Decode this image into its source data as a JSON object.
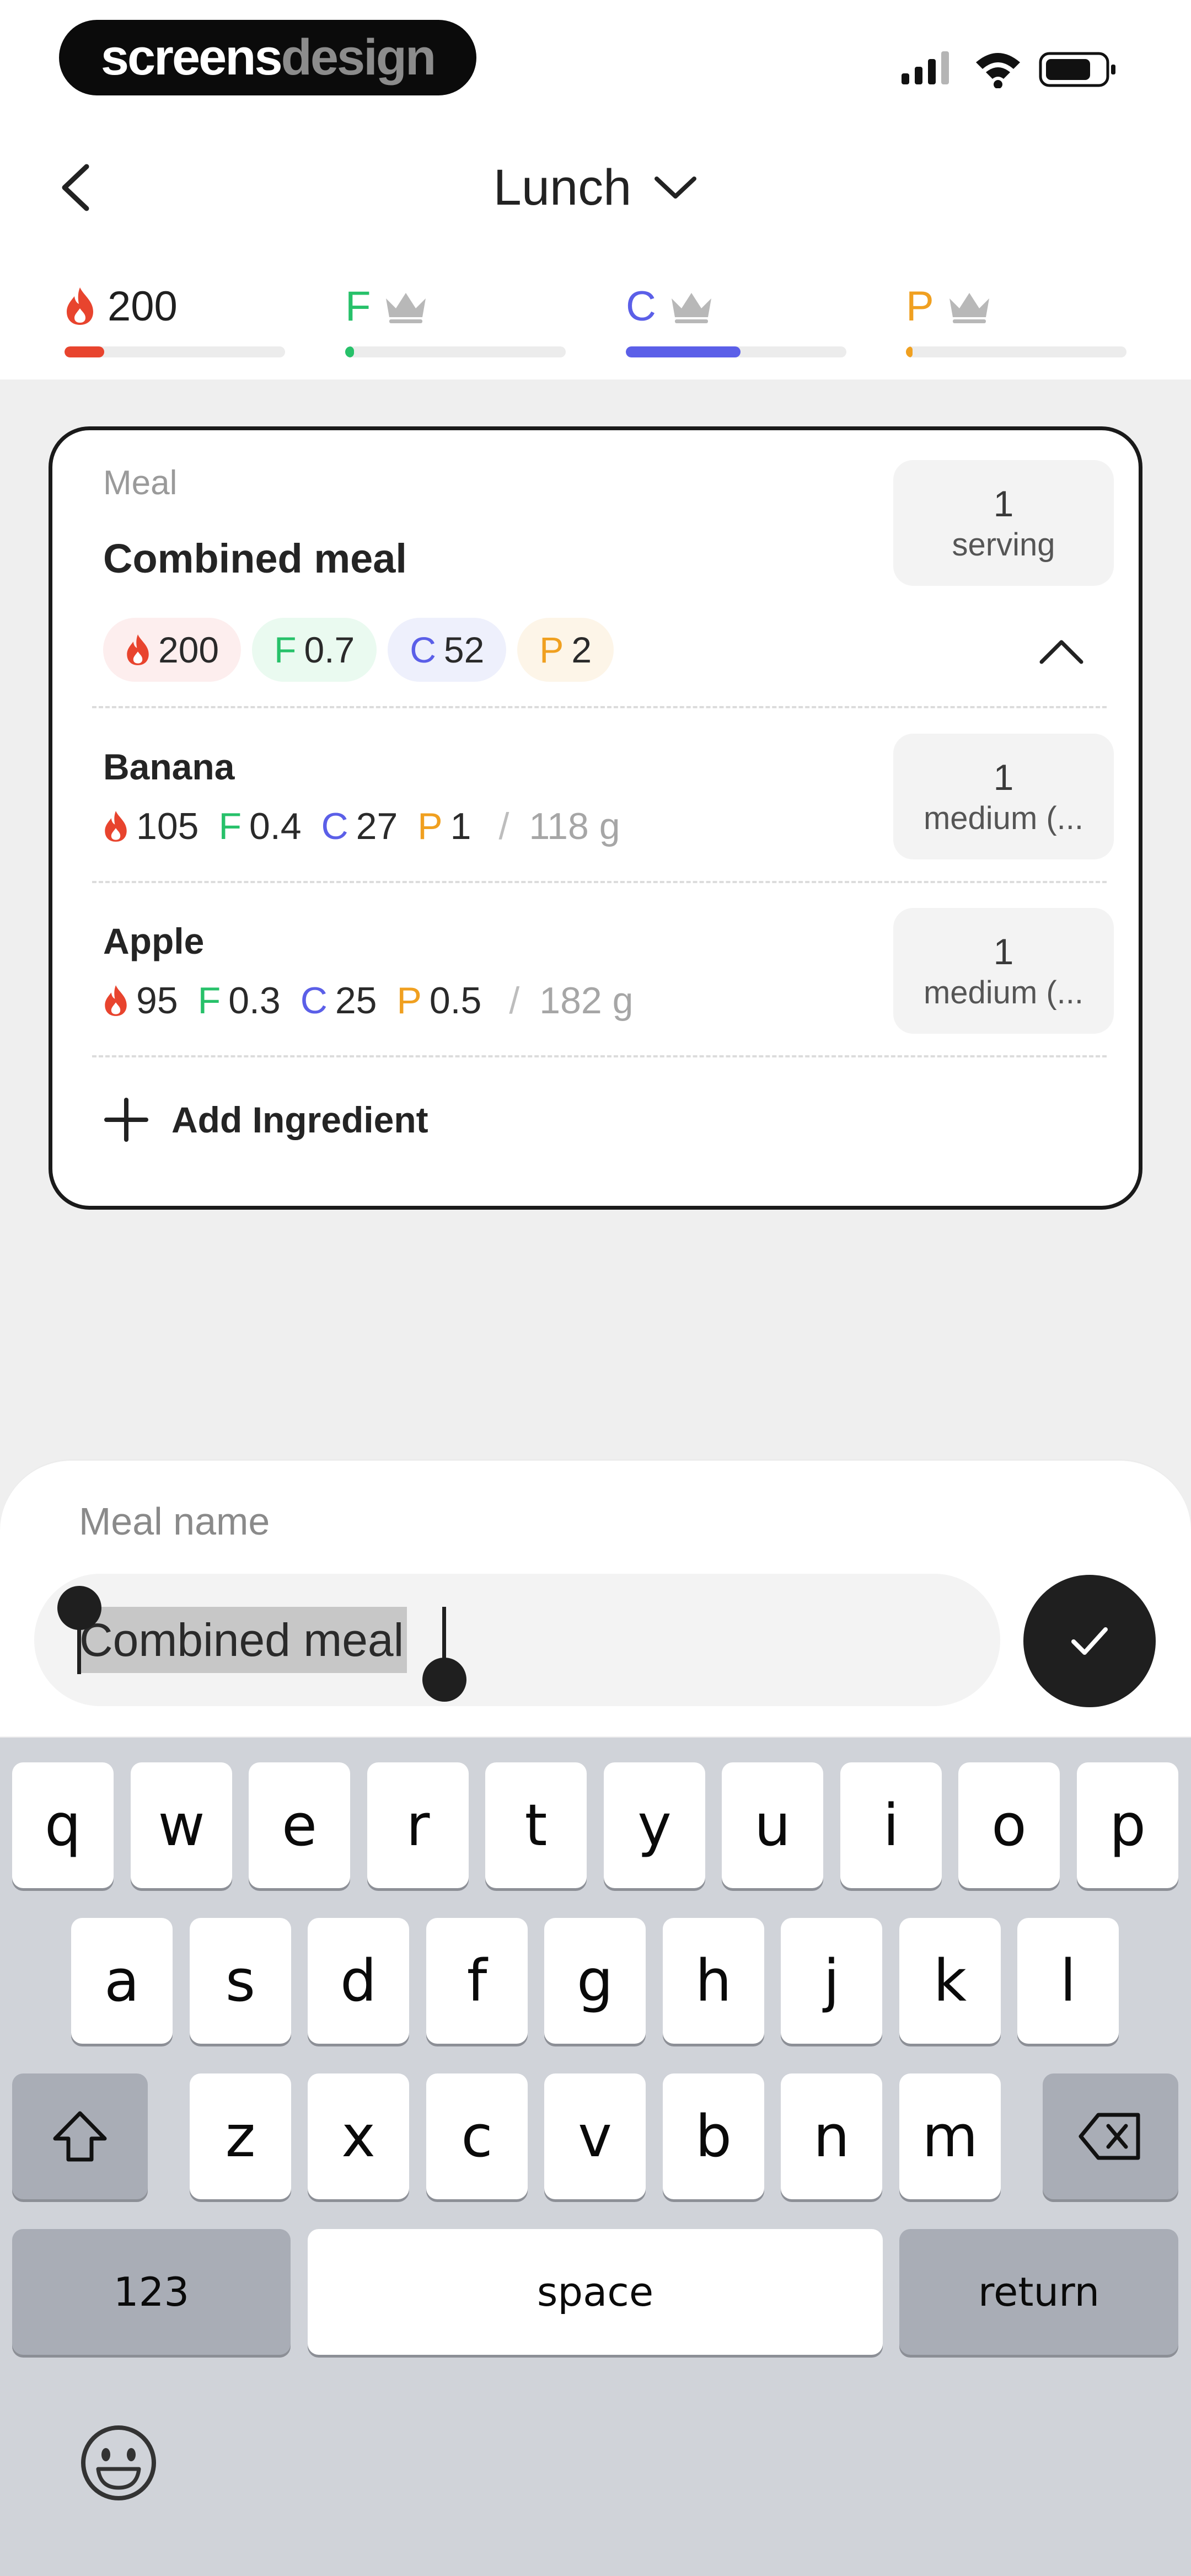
{
  "statusbar": {
    "brand_left": "screens",
    "brand_right": "design"
  },
  "header": {
    "title": "Lunch"
  },
  "macros": [
    {
      "key": "calories",
      "label": "",
      "value": "200",
      "color": "#e8442e",
      "progress": 0.18
    },
    {
      "key": "fat",
      "label": "F",
      "value": "",
      "color": "#27c16a",
      "progress": 0.04
    },
    {
      "key": "carbs",
      "label": "C",
      "value": "",
      "color": "#5b5fe8",
      "progress": 0.52
    },
    {
      "key": "protein",
      "label": "P",
      "value": "",
      "color": "#f0a020",
      "progress": 0.03
    }
  ],
  "meal_card": {
    "label": "Meal",
    "name": "Combined meal",
    "serving_qty": "1",
    "serving_unit": "serving",
    "chips": {
      "calories": "200",
      "fat_label": "F",
      "fat": "0.7",
      "carbs_label": "C",
      "carbs": "52",
      "protein_label": "P",
      "protein": "2"
    },
    "ingredients": [
      {
        "name": "Banana",
        "calories": "105",
        "fat_label": "F",
        "fat": "0.4",
        "carbs_label": "C",
        "carbs": "27",
        "protein_label": "P",
        "protein": "1",
        "separator": "/",
        "weight": "118 g",
        "qty": "1",
        "unit": "medium (..."
      },
      {
        "name": "Apple",
        "calories": "95",
        "fat_label": "F",
        "fat": "0.3",
        "carbs_label": "C",
        "carbs": "25",
        "protein_label": "P",
        "protein": "0.5",
        "separator": "/",
        "weight": "182 g",
        "qty": "1",
        "unit": "medium (..."
      }
    ],
    "add_ingredient_label": "Add Ingredient"
  },
  "meal_name_sheet": {
    "label": "Meal name",
    "value": "Combined meal"
  },
  "keyboard": {
    "row1": [
      "q",
      "w",
      "e",
      "r",
      "t",
      "y",
      "u",
      "i",
      "o",
      "p"
    ],
    "row2": [
      "a",
      "s",
      "d",
      "f",
      "g",
      "h",
      "j",
      "k",
      "l"
    ],
    "row3": [
      "z",
      "x",
      "c",
      "v",
      "b",
      "n",
      "m"
    ],
    "numbers_label": "123",
    "space_label": "space",
    "return_label": "return"
  },
  "colors": {
    "calories": "#e8442e",
    "fat": "#27c16a",
    "carbs": "#5b5fe8",
    "protein": "#f0a020"
  }
}
